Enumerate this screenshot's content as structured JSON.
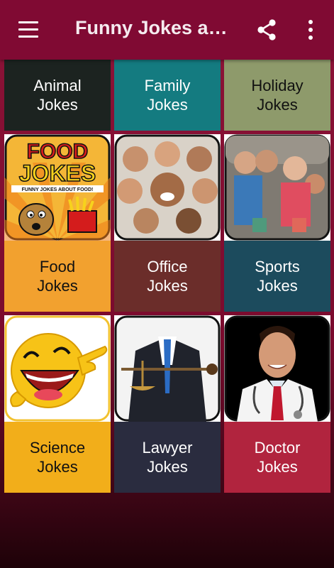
{
  "app": {
    "title": "Funny Jokes a…",
    "icons": {
      "menu": "hamburger-menu-icon",
      "share": "share-icon",
      "more": "more-vert-icon"
    },
    "colors": {
      "appbar": "#800a33",
      "background_top": "#8a1236",
      "background_bottom": "#1e0208"
    }
  },
  "categories": [
    {
      "id": "animal",
      "line1": "Animal",
      "line2": "Jokes",
      "color": "#1c2320"
    },
    {
      "id": "family",
      "line1": "Family",
      "line2": "Jokes",
      "color": "#147b80"
    },
    {
      "id": "holiday",
      "line1": "Holiday",
      "line2": "Jokes",
      "color": "#8e9a6b"
    },
    {
      "id": "food",
      "line1": "Food",
      "line2": "Jokes",
      "color": "#f2a12f",
      "image_text": [
        "FOOD",
        "JOKES",
        "FUNNY JOKES ABOUT FOOD!"
      ]
    },
    {
      "id": "office",
      "line1": "Office",
      "line2": "Jokes",
      "color": "#6b2d2a"
    },
    {
      "id": "sports",
      "line1": "Sports",
      "line2": "Jokes",
      "color": "#1c4b5d"
    },
    {
      "id": "science",
      "line1": "Science",
      "line2": "Jokes",
      "color": "#f2ae1a"
    },
    {
      "id": "lawyer",
      "line1": "Lawyer",
      "line2": "Jokes",
      "color": "#2a2c3f"
    },
    {
      "id": "doctor",
      "line1": "Doctor",
      "line2": "Jokes",
      "color": "#b1243e"
    }
  ]
}
